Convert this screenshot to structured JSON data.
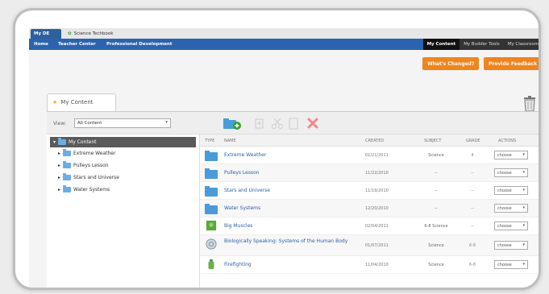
{
  "tabs": {
    "my_tab": "My DE",
    "science_tab": "Science Techbook"
  },
  "nav": {
    "home": "Home",
    "teacher_center": "Teacher Center",
    "professional_development": "Professional Development",
    "right": [
      "My Content",
      "My Builder Tools",
      "My Classrooms"
    ]
  },
  "buttons": {
    "whats_changed": "What's Changed?",
    "provide_feedback": "Provide Feedback"
  },
  "content_tab": "My Content",
  "toolbar": {
    "view_label": "View:",
    "view_value": "All Content"
  },
  "tree": {
    "root": "My Content",
    "items": [
      "Extreme Weather",
      "Pulleys Lesson",
      "Stars and Universe",
      "Water Systems"
    ]
  },
  "table": {
    "headers": [
      "Type",
      "Name",
      "Created",
      "Subject",
      "Grade",
      "Actions"
    ],
    "rows": [
      {
        "icon": "folder",
        "name": "Extreme Weather",
        "created": "01/21/2011",
        "subject": "Science",
        "grade": "4",
        "action": "choose"
      },
      {
        "icon": "folder",
        "name": "Pulleys Lesson",
        "created": "11/22/2010",
        "subject": "--",
        "grade": "--",
        "action": "choose"
      },
      {
        "icon": "folder",
        "name": "Stars and Universe",
        "created": "11/19/2010",
        "subject": "--",
        "grade": "--",
        "action": "choose"
      },
      {
        "icon": "folder",
        "name": "Water Systems",
        "created": "12/20/2010",
        "subject": "--",
        "grade": "--",
        "action": "choose"
      },
      {
        "icon": "image",
        "name": "Big Muscles",
        "created": "02/04/2011",
        "subject": "6-8 Science",
        "grade": "--",
        "action": "choose"
      },
      {
        "icon": "globe",
        "name": "Biologically Speaking: Systems of the Human Body",
        "created": "01/07/2011",
        "subject": "Science",
        "grade": "6-8",
        "action": "choose"
      },
      {
        "icon": "bottle",
        "name": "Firefighting",
        "created": "11/04/2010",
        "subject": "Science",
        "grade": "6-8",
        "action": "choose"
      }
    ]
  },
  "colors": {
    "nav_blue": "#2b63ae",
    "orange": "#f0841d",
    "link_blue": "#2a5ea8",
    "folder_blue": "#6aaee3"
  }
}
